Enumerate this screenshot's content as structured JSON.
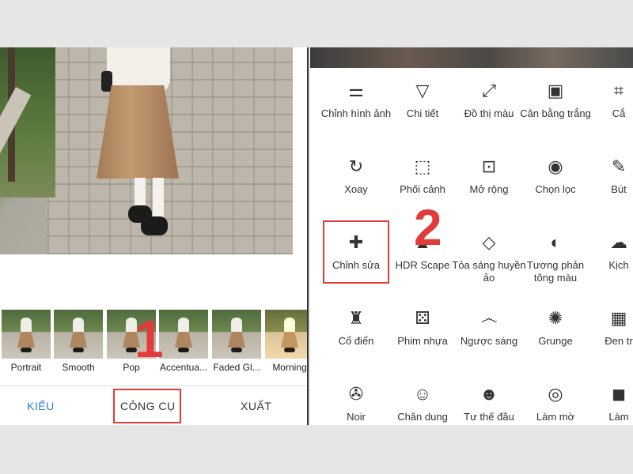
{
  "left": {
    "filters": [
      "Portrait",
      "Smooth",
      "Pop",
      "Accentua...",
      "Faded Gl...",
      "Morning"
    ],
    "tabs": {
      "styles": "KIỂU",
      "tools": "CÔNG CỤ",
      "export": "XUẤT"
    },
    "step_number": "1"
  },
  "right": {
    "step_number": "2",
    "tools": [
      {
        "label": "Chỉnh hình ảnh",
        "icon": "sliders-icon",
        "glyph": "⚌"
      },
      {
        "label": "Chi tiết",
        "icon": "triangle-down-icon",
        "glyph": "▽"
      },
      {
        "label": "Đồ thị màu",
        "icon": "curve-icon",
        "glyph": "⤢"
      },
      {
        "label": "Cân bằng trắng",
        "icon": "white-balance-icon",
        "glyph": "▣"
      },
      {
        "label": "Cắ",
        "icon": "crop-icon",
        "glyph": "⌗"
      },
      {
        "label": "Xoay",
        "icon": "rotate-icon",
        "glyph": "↻"
      },
      {
        "label": "Phối cảnh",
        "icon": "perspective-icon",
        "glyph": "⬚"
      },
      {
        "label": "Mở rộng",
        "icon": "expand-icon",
        "glyph": "⊡"
      },
      {
        "label": "Chọn lọc",
        "icon": "target-icon",
        "glyph": "◉"
      },
      {
        "label": "Bút",
        "icon": "brush-icon",
        "glyph": "✎"
      },
      {
        "label": "Chỉnh sửa",
        "icon": "bandage-icon",
        "glyph": "✚"
      },
      {
        "label": "HDR Scape",
        "icon": "hdr-icon",
        "glyph": "▲"
      },
      {
        "label": "Tỏa sáng huyền ảo",
        "icon": "diamond-icon",
        "glyph": "◇"
      },
      {
        "label": "Tương phản tông màu",
        "icon": "half-circle-icon",
        "glyph": "◐"
      },
      {
        "label": "Kịch",
        "icon": "cloud-icon",
        "glyph": "☁"
      },
      {
        "label": "Cổ điển",
        "icon": "lamp-icon",
        "glyph": "♜"
      },
      {
        "label": "Phim nhựa",
        "icon": "dice-icon",
        "glyph": "⚄"
      },
      {
        "label": "Ngược sáng",
        "icon": "mustache-icon",
        "glyph": "෴"
      },
      {
        "label": "Grunge",
        "icon": "grunge-icon",
        "glyph": "✺"
      },
      {
        "label": "Đen tr",
        "icon": "image-icon",
        "glyph": "▦"
      },
      {
        "label": "Noir",
        "icon": "film-reel-icon",
        "glyph": "✇"
      },
      {
        "label": "Chân dung",
        "icon": "face-icon",
        "glyph": "☺"
      },
      {
        "label": "Tư thế đầu",
        "icon": "face-frame-icon",
        "glyph": "☻"
      },
      {
        "label": "Làm mờ",
        "icon": "blur-icon",
        "glyph": "◎"
      },
      {
        "label": "Làm",
        "icon": "vignette-icon",
        "glyph": "◼"
      }
    ]
  },
  "colors": {
    "accent": "#2d7fd3",
    "highlight": "#e23b3b"
  }
}
